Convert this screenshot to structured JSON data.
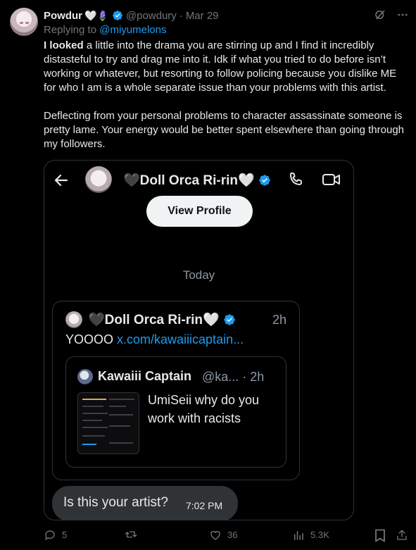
{
  "tweet": {
    "display_name": "Powdur",
    "name_emoji": "🤍🪻",
    "handle": "@powdury",
    "separator": "·",
    "date": "Mar 29",
    "replying_prefix": "Replying to",
    "replying_to": "@miyumelons",
    "para1_bold": "I looked",
    "para1_rest": " a little into the drama you are stirring up and I find it incredibly distasteful to try and drag me into it. Idk if what you tried to do before isn’t working or whatever, but resorting to follow policing because you dislike ME for who I am is a whole separate issue than your problems with this artist.",
    "para2": "Deflecting from your personal problems to character assassinate someone is pretty lame. Your energy would be better spent elsewhere than going through my followers."
  },
  "dm": {
    "contact_name": "🖤Doll Orca Ri-rin🤍",
    "view_profile": "View Profile",
    "day_label": "Today",
    "shared_post": {
      "author": "🖤Doll Orca Ri-rin🤍",
      "time": "2h",
      "text": "YOOOO ",
      "link": "x.com/kawaiiicaptain...",
      "quote": {
        "author": "Kawaiii Captain",
        "handle": "@ka... · 2h",
        "text": "UmiSeii why do you work with racists"
      }
    },
    "message": {
      "text": "Is this your artist?",
      "time": "7:02 PM"
    }
  },
  "actions": {
    "replies": "5",
    "reposts": "",
    "likes": "36",
    "views": "5.3K"
  },
  "colors": {
    "accent": "#1d9bf0",
    "muted": "#71767b",
    "bubble": "#2f3336"
  }
}
